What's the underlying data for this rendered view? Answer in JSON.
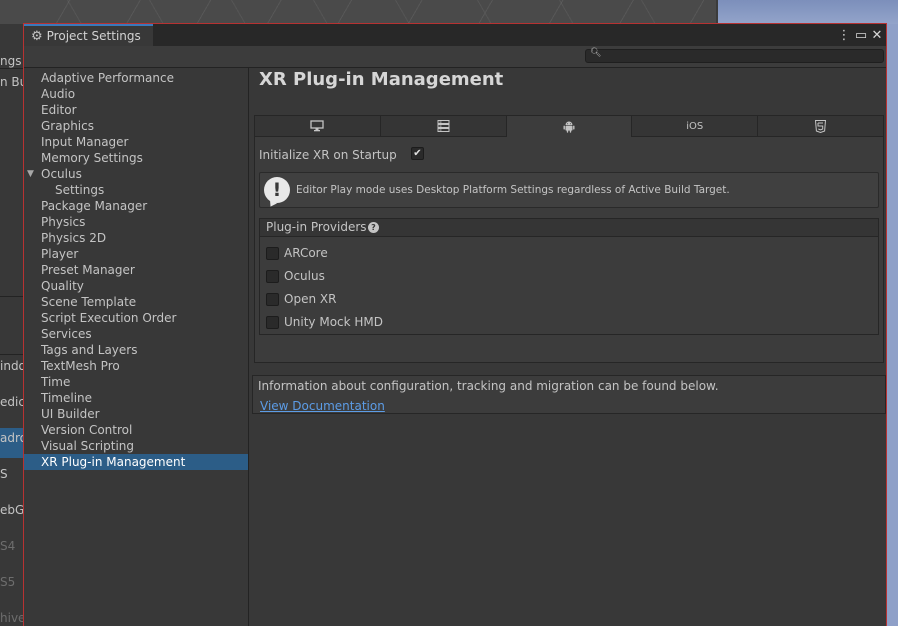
{
  "background": {
    "left_items": [
      "ngs",
      "n Bui",
      "indo",
      "edica",
      "adro",
      "S",
      "ebG",
      "S4",
      "S5",
      "hive"
    ]
  },
  "window": {
    "title": "Project Settings",
    "controls": {
      "menu": "⋮",
      "maximize": "▭",
      "close": "✕"
    },
    "search": {
      "placeholder": "",
      "value": ""
    }
  },
  "sidebar": {
    "items": [
      {
        "label": "Adaptive Performance"
      },
      {
        "label": "Audio"
      },
      {
        "label": "Editor"
      },
      {
        "label": "Graphics"
      },
      {
        "label": "Input Manager"
      },
      {
        "label": "Memory Settings"
      },
      {
        "label": "Oculus",
        "expanded": true
      },
      {
        "label": "Settings",
        "indent": 1
      },
      {
        "label": "Package Manager"
      },
      {
        "label": "Physics"
      },
      {
        "label": "Physics 2D"
      },
      {
        "label": "Player"
      },
      {
        "label": "Preset Manager"
      },
      {
        "label": "Quality"
      },
      {
        "label": "Scene Template"
      },
      {
        "label": "Script Execution Order"
      },
      {
        "label": "Services"
      },
      {
        "label": "Tags and Layers"
      },
      {
        "label": "TextMesh Pro"
      },
      {
        "label": "Time"
      },
      {
        "label": "Timeline"
      },
      {
        "label": "UI Builder"
      },
      {
        "label": "Version Control"
      },
      {
        "label": "Visual Scripting"
      },
      {
        "label": "XR Plug-in Management",
        "selected": true
      }
    ]
  },
  "content": {
    "title": "XR Plug-in Management",
    "platform_tabs": [
      {
        "icon": "desktop-icon",
        "label": ""
      },
      {
        "icon": "server-icon",
        "label": ""
      },
      {
        "icon": "android-icon",
        "label": "",
        "active": true
      },
      {
        "icon": "ios-icon",
        "label": "iOS"
      },
      {
        "icon": "html5-icon",
        "label": ""
      }
    ],
    "initialize": {
      "label": "Initialize XR on Startup",
      "checked": true,
      "check_glyph": "✔"
    },
    "help_box": {
      "icon": "!",
      "text": "Editor Play mode uses Desktop Platform Settings regardless of Active Build Target."
    },
    "providers": {
      "title": "Plug-in Providers",
      "help_glyph": "?",
      "items": [
        {
          "label": "ARCore",
          "checked": false
        },
        {
          "label": "Oculus",
          "checked": false
        },
        {
          "label": "Open XR",
          "checked": false
        },
        {
          "label": "Unity Mock HMD",
          "checked": false
        }
      ]
    },
    "info": {
      "text": "Information about configuration, tracking and migration can be found below.",
      "link": "View Documentation"
    }
  },
  "colors": {
    "accent": "#2c5d87",
    "window_border": "#b73232",
    "link": "#5c9ce6"
  }
}
